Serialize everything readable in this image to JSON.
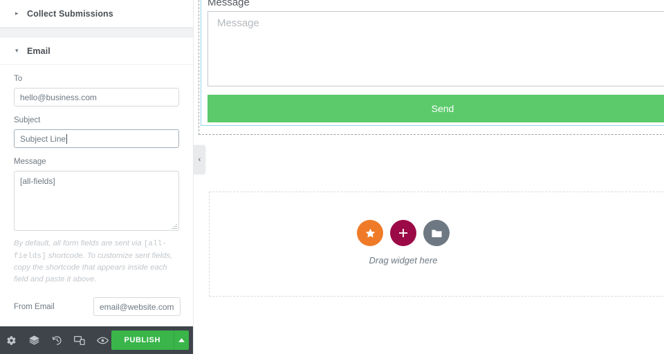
{
  "panel": {
    "sections": [
      {
        "id": "collect-submissions",
        "label": "Collect Submissions",
        "state": "collapsed",
        "caret": "▸"
      },
      {
        "id": "email",
        "label": "Email",
        "state": "expanded",
        "caret": "▾"
      }
    ],
    "controls": {
      "to": {
        "label": "To",
        "value": "hello@business.com",
        "placeholder": "hello@business.com"
      },
      "subject": {
        "label": "Subject",
        "value": "Subject Line",
        "placeholder": "Subject Line",
        "focused": true
      },
      "message": {
        "label": "Message",
        "value": "[all-fields]",
        "placeholder": "[all-fields]"
      },
      "help": {
        "part1": "By default, all form fields are sent via ",
        "code1": "[all-fields]",
        "part2": " shortcode. To customize sent fields, copy the shortcode that appears inside each field and paste it above."
      },
      "from_email": {
        "label": "From Email",
        "value": "email@website.com",
        "placeholder": "email@website.com"
      },
      "next_field": {
        "label": "",
        "value": "",
        "placeholder": ""
      }
    }
  },
  "bottombar": {
    "icons": [
      {
        "name": "gear-icon",
        "title": "Settings"
      },
      {
        "name": "layers-icon",
        "title": "Navigator"
      },
      {
        "name": "history-icon",
        "title": "History"
      },
      {
        "name": "responsive-icon",
        "title": "Responsive Mode"
      },
      {
        "name": "eye-icon",
        "title": "Preview Changes"
      }
    ],
    "publish": {
      "label": "PUBLISH",
      "caret": "▴",
      "color": "#39b54a"
    }
  },
  "canvas": {
    "collapse_handle": {
      "icon": "‹"
    },
    "preview_form": {
      "field_label": "Message",
      "textarea_placeholder": "Message",
      "submit_label": "Send",
      "submit_color": "#5cca6b",
      "selection_color": "#93d5ea"
    },
    "dropzone": {
      "text": "Drag widget here",
      "buttons": [
        {
          "name": "favorites-star-button",
          "icon": "star",
          "color": "#ef7b28"
        },
        {
          "name": "add-section-button",
          "icon": "plus",
          "color": "#9b0a46"
        },
        {
          "name": "templates-folder-button",
          "icon": "folder",
          "color": "#6d7882"
        }
      ]
    }
  }
}
